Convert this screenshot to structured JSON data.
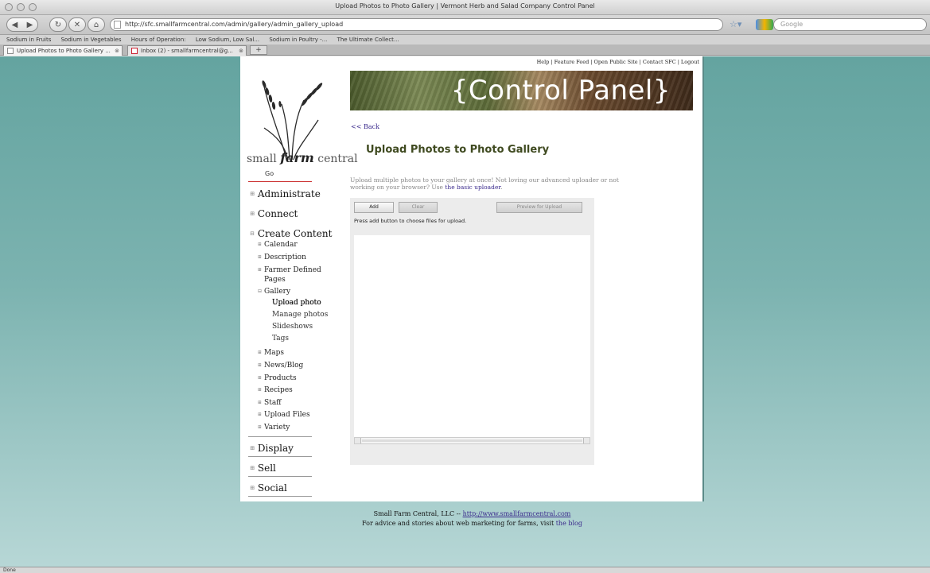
{
  "window": {
    "title": "Upload Photos to Photo Gallery | Vermont Herb and Salad Company Control Panel"
  },
  "toolbar": {
    "url": "http://sfc.smallfarmcentral.com/admin/gallery/admin_gallery_upload",
    "search_placeholder": "Google"
  },
  "bookmarks": [
    "Sodium in Fruits",
    "Sodium in Vegetables",
    "Hours of Operation:",
    "Low Sodium, Low Sal...",
    "Sodium in Poultry -...",
    "The Ultimate Collect..."
  ],
  "tabs": [
    {
      "label": "Upload Photos to Photo Gallery ..."
    },
    {
      "label": "Inbox (2) - smallfarmcentral@g..."
    }
  ],
  "top_links": [
    "Help",
    "Feature Feed",
    "Open Public Site",
    "Contact SFC",
    "Logout"
  ],
  "logo": {
    "word1": "small",
    "word2": "farm",
    "word3": "central"
  },
  "go_label": "Go",
  "nav": {
    "administrate": "Administrate",
    "connect": "Connect",
    "create_content": "Create Content",
    "calendar": "Calendar",
    "description": "Description",
    "farmer_defined_1": "Farmer Defined",
    "farmer_defined_2": "Pages",
    "gallery": "Gallery",
    "upload_photo": "Upload photo",
    "manage_photos": "Manage photos",
    "slideshows": "Slideshows",
    "tags": "Tags",
    "maps": "Maps",
    "news_blog": "News/Blog",
    "products": "Products",
    "recipes": "Recipes",
    "staff": "Staff",
    "upload_files": "Upload Files",
    "variety": "Variety",
    "display": "Display",
    "sell": "Sell",
    "social": "Social"
  },
  "banner": {
    "title": "{Control Panel}"
  },
  "main": {
    "back_label": "<< Back",
    "title": "Upload Photos to Photo Gallery",
    "intro_text": "Upload multiple photos to your gallery at once! Not loving our advanced uploader or not working on your browser? Use ",
    "intro_link": "the basic uploader",
    "intro_end": "."
  },
  "uploader": {
    "add_label": "Add",
    "clear_label": "Clear",
    "preview_label": "Preview for Upload",
    "hint": "Press add button to choose files for upload."
  },
  "footer": {
    "line1_prefix": "Small Farm Central, LLC -- ",
    "line1_link": "http://www.smallfarmcentral.com",
    "line2_prefix": "For advice and stories about web marketing for farms, visit ",
    "line2_link": "the blog"
  },
  "status": {
    "text": "Done"
  },
  "colors": {
    "accent_link": "#3a2a8c",
    "title_green": "#3f4a20",
    "background_teal": "#64a4a0"
  }
}
